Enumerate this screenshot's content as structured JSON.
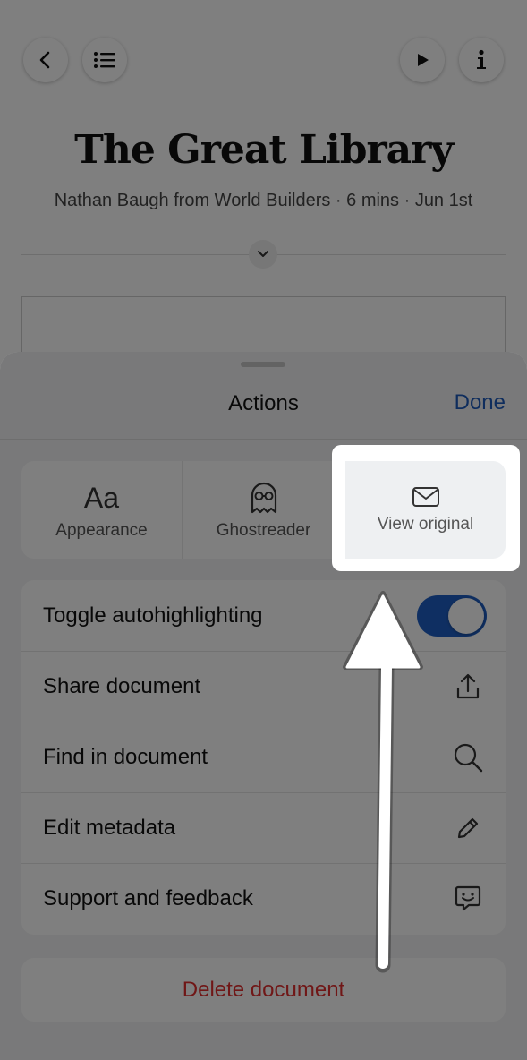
{
  "article": {
    "title": "The Great Library",
    "meta": "Nathan Baugh from World Builders · 6 mins · Jun 1st"
  },
  "sheet": {
    "title": "Actions",
    "done_label": "Done",
    "top_actions": [
      {
        "label": "Appearance",
        "icon": "Aa"
      },
      {
        "label": "Ghostreader",
        "icon": "ghost-icon"
      },
      {
        "label": "View original",
        "icon": "envelope-icon"
      }
    ],
    "rows": [
      {
        "label": "Toggle autohighlighting",
        "icon": "toggle"
      },
      {
        "label": "Share document",
        "icon": "share-icon"
      },
      {
        "label": "Find in document",
        "icon": "search-icon"
      },
      {
        "label": "Edit metadata",
        "icon": "pencil-icon"
      },
      {
        "label": "Support and feedback",
        "icon": "chat-smile-icon"
      }
    ],
    "autohighlighting_on": true,
    "delete_label": "Delete document"
  },
  "colors": {
    "accent": "#1e5bbb",
    "danger": "#e02e2e"
  }
}
